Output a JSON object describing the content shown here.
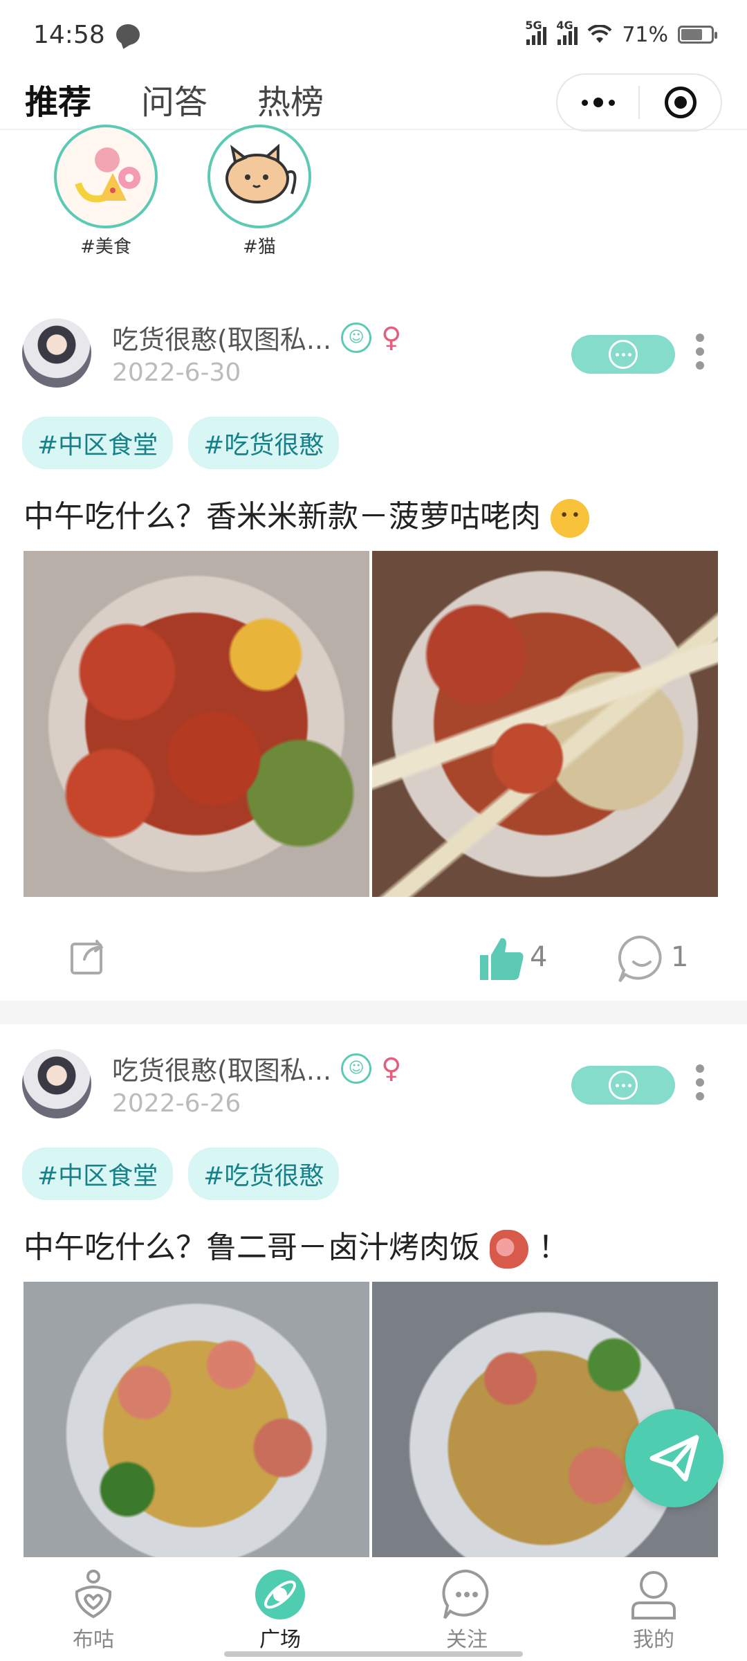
{
  "status_bar": {
    "time": "14:58",
    "net1": "5G",
    "net2": "4G",
    "battery_pct": "71%"
  },
  "header": {
    "tabs": [
      {
        "label": "推荐",
        "active": true
      },
      {
        "label": "问答",
        "active": false
      },
      {
        "label": "热榜",
        "active": false
      }
    ]
  },
  "topics": [
    {
      "label": "#美食",
      "icon": "food-illustration"
    },
    {
      "label": "#猫",
      "icon": "cat-illustration"
    }
  ],
  "posts": [
    {
      "author": "吃货很憨(取图私...",
      "date": "2022-6-30",
      "tags": [
        "#中区食堂",
        "#吃货很憨"
      ],
      "text": "中午吃什么？香米米新款－菠萝咕咾肉",
      "emoji": "hugging-face-emoji",
      "likes": "4",
      "comments": "1"
    },
    {
      "author": "吃货很憨(取图私...",
      "date": "2022-6-26",
      "tags": [
        "#中区食堂",
        "#吃货很憨"
      ],
      "text": "中午吃什么？鲁二哥－卤汁烤肉饭",
      "emoji": "meat-emoji",
      "text_suffix": "！"
    }
  ],
  "bottom_nav": [
    {
      "label": "布咕",
      "icon": "heart-person-icon"
    },
    {
      "label": "广场",
      "icon": "planet-icon",
      "active": true
    },
    {
      "label": "关注",
      "icon": "chat-bubble-icon"
    },
    {
      "label": "我的",
      "icon": "profile-icon"
    }
  ],
  "colors": {
    "accent": "#4ecdb1",
    "tag_bg": "#d8f6f4",
    "tag_text": "#17808a",
    "female": "#e0607e"
  }
}
